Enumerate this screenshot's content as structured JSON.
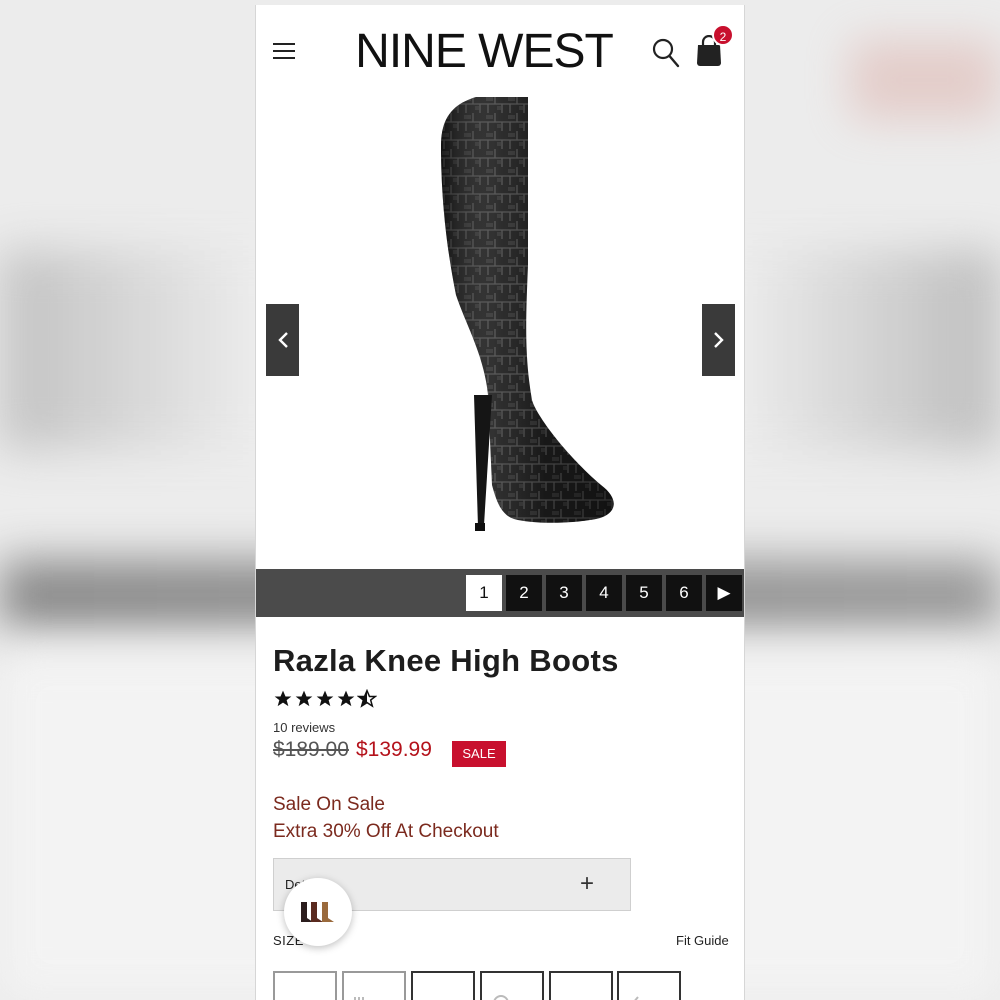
{
  "brand": {
    "logo_text": "NINE WEST"
  },
  "header": {
    "cart_count": "2"
  },
  "gallery": {
    "pages": [
      "1",
      "2",
      "3",
      "4",
      "5",
      "6"
    ],
    "active_page": "1",
    "next_symbol": "▶"
  },
  "product": {
    "title": "Razla Knee High Boots",
    "rating": 4.5,
    "reviews": "10 reviews",
    "old_price": "$189.00",
    "sale_price": "$139.99",
    "sale_badge": "SALE",
    "promo_line1": "Sale On Sale",
    "promo_line2": "Extra 30% Off At Checkout"
  },
  "details": {
    "label": "Details"
  },
  "size": {
    "label": "SIZE",
    "fit_guide": "Fit Guide"
  },
  "colors": {
    "accent": "#c8102e",
    "promo": "#7b2a1e",
    "pager_bg": "#4b4b4b"
  }
}
